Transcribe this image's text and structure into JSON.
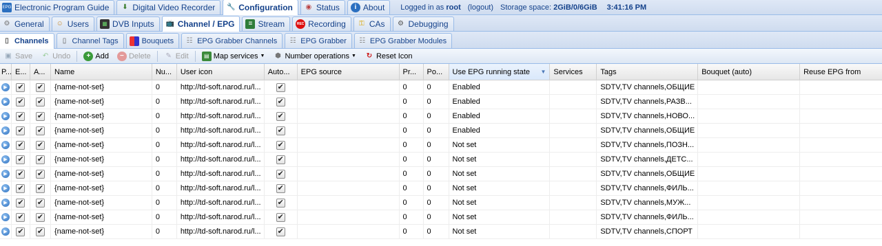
{
  "top_tabs": [
    {
      "label": "Electronic Program Guide",
      "icon": "epg-icon"
    },
    {
      "label": "Digital Video Recorder",
      "icon": "dvr-icon"
    },
    {
      "label": "Configuration",
      "icon": "wrench-icon",
      "active": true
    },
    {
      "label": "Status",
      "icon": "eye-icon"
    },
    {
      "label": "About",
      "icon": "info-icon"
    }
  ],
  "status": {
    "logged_in_prefix": "Logged in as",
    "user": "root",
    "logout": "(logout)",
    "storage_label": "Storage space:",
    "storage_value": "2GiB/0/6GiB",
    "time": "3:41:16 PM"
  },
  "config_tabs": [
    {
      "label": "General",
      "icon": "gear-icon"
    },
    {
      "label": "Users",
      "icon": "users-icon"
    },
    {
      "label": "DVB Inputs",
      "icon": "dvb-icon"
    },
    {
      "label": "Channel / EPG",
      "icon": "tv-icon",
      "active": true
    },
    {
      "label": "Stream",
      "icon": "stream-icon"
    },
    {
      "label": "Recording",
      "icon": "rec-icon"
    },
    {
      "label": "CAs",
      "icon": "key-icon"
    },
    {
      "label": "Debugging",
      "icon": "bug-icon"
    }
  ],
  "sub_tabs": [
    {
      "label": "Channels",
      "icon": "channels-icon",
      "active": true
    },
    {
      "label": "Channel Tags",
      "icon": "tag-icon"
    },
    {
      "label": "Bouquets",
      "icon": "bouquet-icon"
    },
    {
      "label": "EPG Grabber Channels",
      "icon": "grabber-icon"
    },
    {
      "label": "EPG Grabber",
      "icon": "grabber-icon"
    },
    {
      "label": "EPG Grabber Modules",
      "icon": "grabber-icon"
    }
  ],
  "toolbar": {
    "save": "Save",
    "undo": "Undo",
    "add": "Add",
    "delete": "Delete",
    "edit": "Edit",
    "map_services": "Map services",
    "number_operations": "Number operations",
    "reset_icon": "Reset Icon"
  },
  "columns": [
    "P...",
    "E...",
    "A...",
    "Name",
    "Nu...",
    "User icon",
    "Auto...",
    "EPG source",
    "Pr...",
    "Po...",
    "Use EPG running state",
    "Services",
    "Tags",
    "Bouquet (auto)",
    "Reuse EPG from"
  ],
  "rows": [
    {
      "name": "{name-not-set}",
      "number": "0",
      "user_icon": "http://td-soft.narod.ru/l...",
      "priority": "0",
      "postfix": "0",
      "epg_running": "Enabled",
      "tags": "SDTV,TV channels,ОБЩИЕ"
    },
    {
      "name": "{name-not-set}",
      "number": "0",
      "user_icon": "http://td-soft.narod.ru/l...",
      "priority": "0",
      "postfix": "0",
      "epg_running": "Enabled",
      "tags": "SDTV,TV channels,РАЗВ..."
    },
    {
      "name": "{name-not-set}",
      "number": "0",
      "user_icon": "http://td-soft.narod.ru/l...",
      "priority": "0",
      "postfix": "0",
      "epg_running": "Enabled",
      "tags": "SDTV,TV channels,НОВО..."
    },
    {
      "name": "{name-not-set}",
      "number": "0",
      "user_icon": "http://td-soft.narod.ru/l...",
      "priority": "0",
      "postfix": "0",
      "epg_running": "Enabled",
      "tags": "SDTV,TV channels,ОБЩИЕ"
    },
    {
      "name": "{name-not-set}",
      "number": "0",
      "user_icon": "http://td-soft.narod.ru/l...",
      "priority": "0",
      "postfix": "0",
      "epg_running": "Not set",
      "tags": "SDTV,TV channels,ПОЗН..."
    },
    {
      "name": "{name-not-set}",
      "number": "0",
      "user_icon": "http://td-soft.narod.ru/l...",
      "priority": "0",
      "postfix": "0",
      "epg_running": "Not set",
      "tags": "SDTV,TV channels,ДЕТС..."
    },
    {
      "name": "{name-not-set}",
      "number": "0",
      "user_icon": "http://td-soft.narod.ru/l...",
      "priority": "0",
      "postfix": "0",
      "epg_running": "Not set",
      "tags": "SDTV,TV channels,ОБЩИЕ"
    },
    {
      "name": "{name-not-set}",
      "number": "0",
      "user_icon": "http://td-soft.narod.ru/l...",
      "priority": "0",
      "postfix": "0",
      "epg_running": "Not set",
      "tags": "SDTV,TV channels,ФИЛЬ..."
    },
    {
      "name": "{name-not-set}",
      "number": "0",
      "user_icon": "http://td-soft.narod.ru/l...",
      "priority": "0",
      "postfix": "0",
      "epg_running": "Not set",
      "tags": "SDTV,TV channels,МУЖ..."
    },
    {
      "name": "{name-not-set}",
      "number": "0",
      "user_icon": "http://td-soft.narod.ru/l...",
      "priority": "0",
      "postfix": "0",
      "epg_running": "Not set",
      "tags": "SDTV,TV channels,ФИЛЬ..."
    },
    {
      "name": "{name-not-set}",
      "number": "0",
      "user_icon": "http://td-soft.narod.ru/l...",
      "priority": "0",
      "postfix": "0",
      "epg_running": "Not set",
      "tags": "SDTV,TV channels,СПОРТ"
    }
  ]
}
